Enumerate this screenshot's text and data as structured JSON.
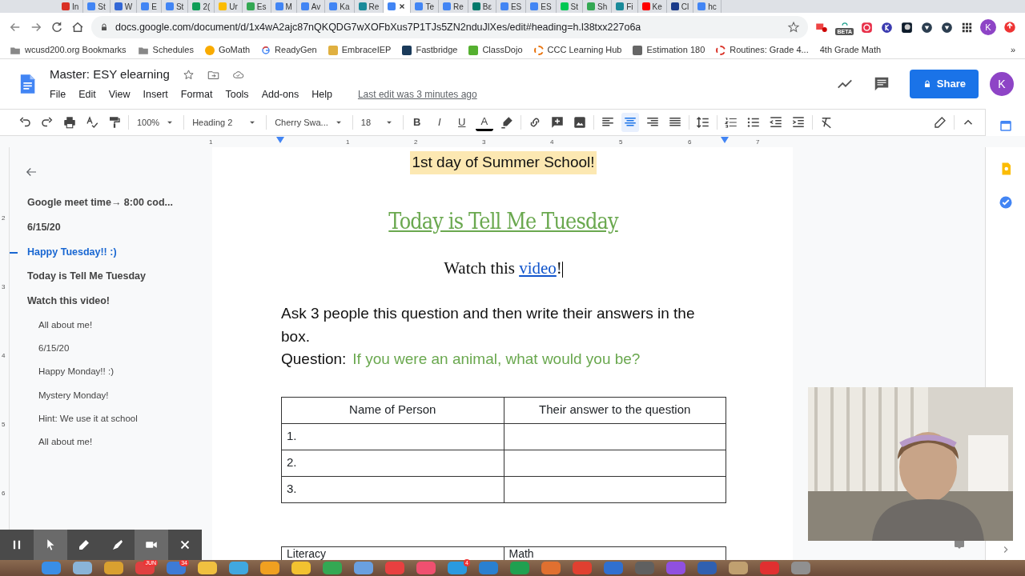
{
  "browser": {
    "tabs": [
      {
        "label": "In",
        "color": "#d93025",
        "selected": false
      },
      {
        "label": "St",
        "color": "#4285f4",
        "selected": false
      },
      {
        "label": "W",
        "color": "#3367d6",
        "selected": false
      },
      {
        "label": "E",
        "color": "#4285f4",
        "selected": false
      },
      {
        "label": "St",
        "color": "#4285f4",
        "selected": false
      },
      {
        "label": "2(",
        "color": "#0f9d58",
        "selected": false
      },
      {
        "label": "Ur",
        "color": "#fbbc04",
        "selected": false
      },
      {
        "label": "Es",
        "color": "#34a853",
        "selected": false
      },
      {
        "label": "M",
        "color": "#4285f4",
        "selected": false
      },
      {
        "label": "Av",
        "color": "#4285f4",
        "selected": false
      },
      {
        "label": "Ka",
        "color": "#4285f4",
        "selected": false
      },
      {
        "label": "Re",
        "color": "#1a8a9a",
        "selected": false
      },
      {
        "color": "#4285f4",
        "selected": true
      },
      {
        "label": "Te",
        "color": "#4285f4",
        "selected": false
      },
      {
        "label": "Re",
        "color": "#4285f4",
        "selected": false
      },
      {
        "label": "Bε",
        "color": "#00796b",
        "selected": false
      },
      {
        "label": "ES",
        "color": "#4285f4",
        "selected": false
      },
      {
        "label": "ES",
        "color": "#4285f4",
        "selected": false
      },
      {
        "label": "St",
        "color": "#00c853",
        "selected": false
      },
      {
        "label": "Sh",
        "color": "#34a853",
        "selected": false
      },
      {
        "label": "Fi",
        "color": "#1a8a9a",
        "selected": false
      },
      {
        "label": "Ke",
        "color": "#ff0000",
        "selected": false
      },
      {
        "label": "Cl",
        "color": "#1a3a8a",
        "selected": false
      },
      {
        "label": "hc",
        "color": "#4285f4",
        "selected": false
      }
    ],
    "url": "docs.google.com/document/d/1x4wA2ajc87nQKQDG7wXOFbXus7P1TJs5ZN2nduJlXes/edit#heading=h.l38txx227o6a",
    "extension_badge": "BETA",
    "profile": "K",
    "bookmarks": [
      {
        "label": "wcusd200.org Bookmarks",
        "kind": "folder"
      },
      {
        "label": "Schedules",
        "kind": "folder"
      },
      {
        "label": "GoMath",
        "kind": "dot",
        "color": "#f9ab00"
      },
      {
        "label": "ReadyGen",
        "kind": "google"
      },
      {
        "label": "EmbraceIEP",
        "kind": "site",
        "color": "#e0b040"
      },
      {
        "label": "Fastbridge",
        "kind": "site",
        "color": "#1a3a5a"
      },
      {
        "label": "ClassDojo",
        "kind": "site",
        "color": "#55b030"
      },
      {
        "label": "CCC Learning Hub",
        "kind": "ring",
        "color": "#e8710a"
      },
      {
        "label": "Estimation 180",
        "kind": "site",
        "color": "#666666"
      },
      {
        "label": "Routines: Grade 4...",
        "kind": "ring",
        "color": "#d93025"
      },
      {
        "label": "4th Grade Math",
        "kind": "none"
      }
    ],
    "more": "»"
  },
  "docs": {
    "title": "Master: ESY elearning",
    "menus": [
      "File",
      "Edit",
      "View",
      "Insert",
      "Format",
      "Tools",
      "Add-ons",
      "Help"
    ],
    "last_edit": "Last edit was 3 minutes ago",
    "share": "Share",
    "avatar": "K",
    "toolbar": {
      "zoom": "100%",
      "style": "Heading 2",
      "font": "Cherry Swa...",
      "size": "18",
      "format_buttons": [
        "B",
        "I",
        "U",
        "A"
      ],
      "align_buttons": [
        {
          "selected": false
        },
        {
          "selected": true
        },
        {
          "selected": false
        },
        {
          "selected": false
        }
      ]
    },
    "ruler": [
      "1",
      "1",
      "2",
      "3",
      "4",
      "5",
      "6",
      "7"
    ],
    "vruler": [
      "2",
      "3",
      "4",
      "5",
      "6"
    ],
    "outline": [
      {
        "label": "Google meet time→ 8:00 cod...",
        "selected": false
      },
      {
        "label": "6/15/20",
        "selected": false
      },
      {
        "label": "Happy Tuesday!! :)",
        "selected": true
      },
      {
        "label": "Today is Tell Me Tuesday",
        "selected": false
      },
      {
        "label": "Watch this video!",
        "selected": false,
        "children": [
          {
            "label": "All about me!",
            "selected": false
          },
          {
            "label": "6/15/20",
            "selected": false
          },
          {
            "label": "Happy Monday!! :)",
            "selected": false
          },
          {
            "label": "Mystery Monday!",
            "selected": false
          },
          {
            "label": "Hint: We use it at school",
            "selected": false
          },
          {
            "label": "All about me!",
            "selected": false
          }
        ]
      }
    ],
    "document": {
      "banner": "1st day of Summer School!",
      "heading": "Today is Tell Me Tuesday",
      "watch": "Watch this ",
      "watch_link": "video",
      "watch_end": "!",
      "instructions": "Ask 3 people this question and then write their answers in the box.",
      "question_label": "Question:",
      "question": "If you were an animal, what would you be?",
      "table": {
        "columns": [
          "Name of Person",
          "Their answer to the question"
        ],
        "rows": [
          [
            "1.",
            ""
          ],
          [
            "2.",
            ""
          ],
          [
            "3.",
            ""
          ]
        ]
      },
      "table2_columns": [
        "Literacy",
        "Math"
      ]
    }
  },
  "recorder": {
    "tools": [
      {
        "kind": "pause",
        "on": false
      },
      {
        "kind": "pointer",
        "on": true
      },
      {
        "kind": "pen",
        "on": false
      },
      {
        "kind": "highlighter",
        "on": false
      },
      {
        "kind": "camera",
        "on": true
      },
      {
        "kind": "close",
        "on": false
      }
    ]
  },
  "dock": {
    "apps": [
      {
        "color": "#3a8ee6"
      },
      {
        "color": "#8ab4d8"
      },
      {
        "color": "#d9a030"
      },
      {
        "color": "#e04040",
        "badge": "JUN"
      },
      {
        "color": "#3d7bd6",
        "badge": "34"
      },
      {
        "color": "#f0c040"
      },
      {
        "color": "#40a8e0"
      },
      {
        "color": "#f0a020"
      },
      {
        "color": "#f2c230"
      },
      {
        "color": "#34a853"
      },
      {
        "color": "#6aa0e0"
      },
      {
        "color": "#e84040"
      },
      {
        "color": "#f05070"
      },
      {
        "color": "#2a9ae0",
        "badge": "4"
      },
      {
        "color": "#2a80d0"
      },
      {
        "color": "#20a050"
      },
      {
        "color": "#e07030"
      },
      {
        "color": "#e04030"
      },
      {
        "color": "#3070d0"
      },
      {
        "color": "#606060"
      },
      {
        "color": "#9050e0"
      },
      {
        "color": "#3060b0"
      },
      {
        "color": "#c0a070"
      },
      {
        "color": "#e03030"
      },
      {
        "color": "#909090"
      }
    ]
  }
}
